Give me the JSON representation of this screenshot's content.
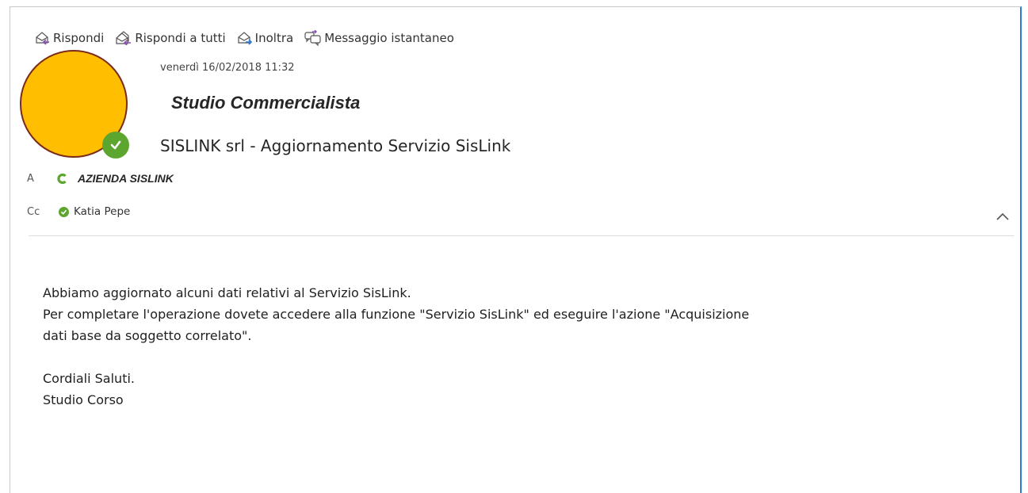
{
  "toolbar": {
    "reply": "Rispondi",
    "reply_all": "Rispondi a tutti",
    "forward": "Inoltra",
    "instant_message": "Messaggio istantaneo"
  },
  "message": {
    "date": "venerdì 16/02/2018 11:32",
    "sender": "Studio Commercialista",
    "subject": "SISLINK srl - Aggiornamento Servizio SisLink"
  },
  "recipients": {
    "to_label": "A",
    "to_name": "AZIENDA SISLINK",
    "cc_label": "Cc",
    "cc_name": "Katia Pepe"
  },
  "body": {
    "line1": "Abbiamo aggiornato alcuni dati relativi al Servizio SisLink.",
    "line2": "Per completare l'operazione dovete accedere alla funzione \"Servizio SisLink\" ed eseguire l'azione \"Acquisizione",
    "line3": "dati base da soggetto correlato\".",
    "closing1": "Cordiali Saluti.",
    "closing2": "Studio Corso"
  },
  "colors": {
    "avatar": "#ffbf00",
    "presence_available": "#5ca630",
    "accent_border": "#2b79d0"
  },
  "icons": {
    "reply": "reply-icon",
    "reply_all": "reply-all-icon",
    "forward": "forward-icon",
    "instant_message": "instant-message-icon",
    "collapse": "chevron-up-icon"
  }
}
